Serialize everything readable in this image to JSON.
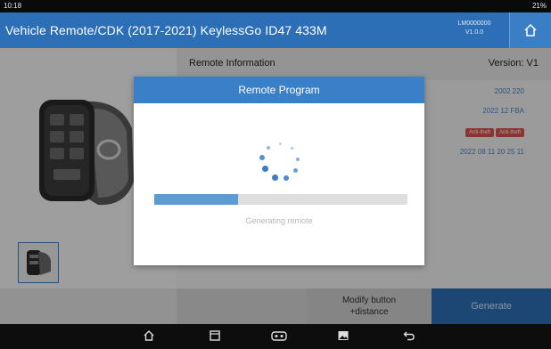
{
  "status_bar": {
    "time": "10:18",
    "battery": "21%"
  },
  "header": {
    "title": "Vehicle Remote/CDK (2017-2021) KeylessGo ID47 433M",
    "device_info_line1": "LM0000000",
    "device_info_line2": "V1.0.0"
  },
  "remote_info": {
    "title": "Remote Information",
    "version": "Version: V1",
    "lines": [
      "2002 220",
      "2022 12 FBA",
      "2022 08 11 20 25 11"
    ],
    "tags": [
      "Anti-theft",
      "Anti-theft"
    ]
  },
  "dialog": {
    "title": "Remote Program",
    "progress": 0.33,
    "progress_text": "Generating remote"
  },
  "footer": {
    "modify_line1": "Modify button",
    "modify_line2": "+distance",
    "generate_label": "Generate"
  },
  "colors": {
    "accent": "#2d6fb6",
    "dialog_header": "#3a80c9",
    "progress_fill": "#5b9bd6",
    "tag": "#d9534f"
  },
  "icons": {
    "header": [
      "home-icon"
    ],
    "navbar": [
      "home-icon",
      "recent-apps-icon",
      "vci-icon",
      "gallery-icon",
      "back-icon"
    ]
  }
}
